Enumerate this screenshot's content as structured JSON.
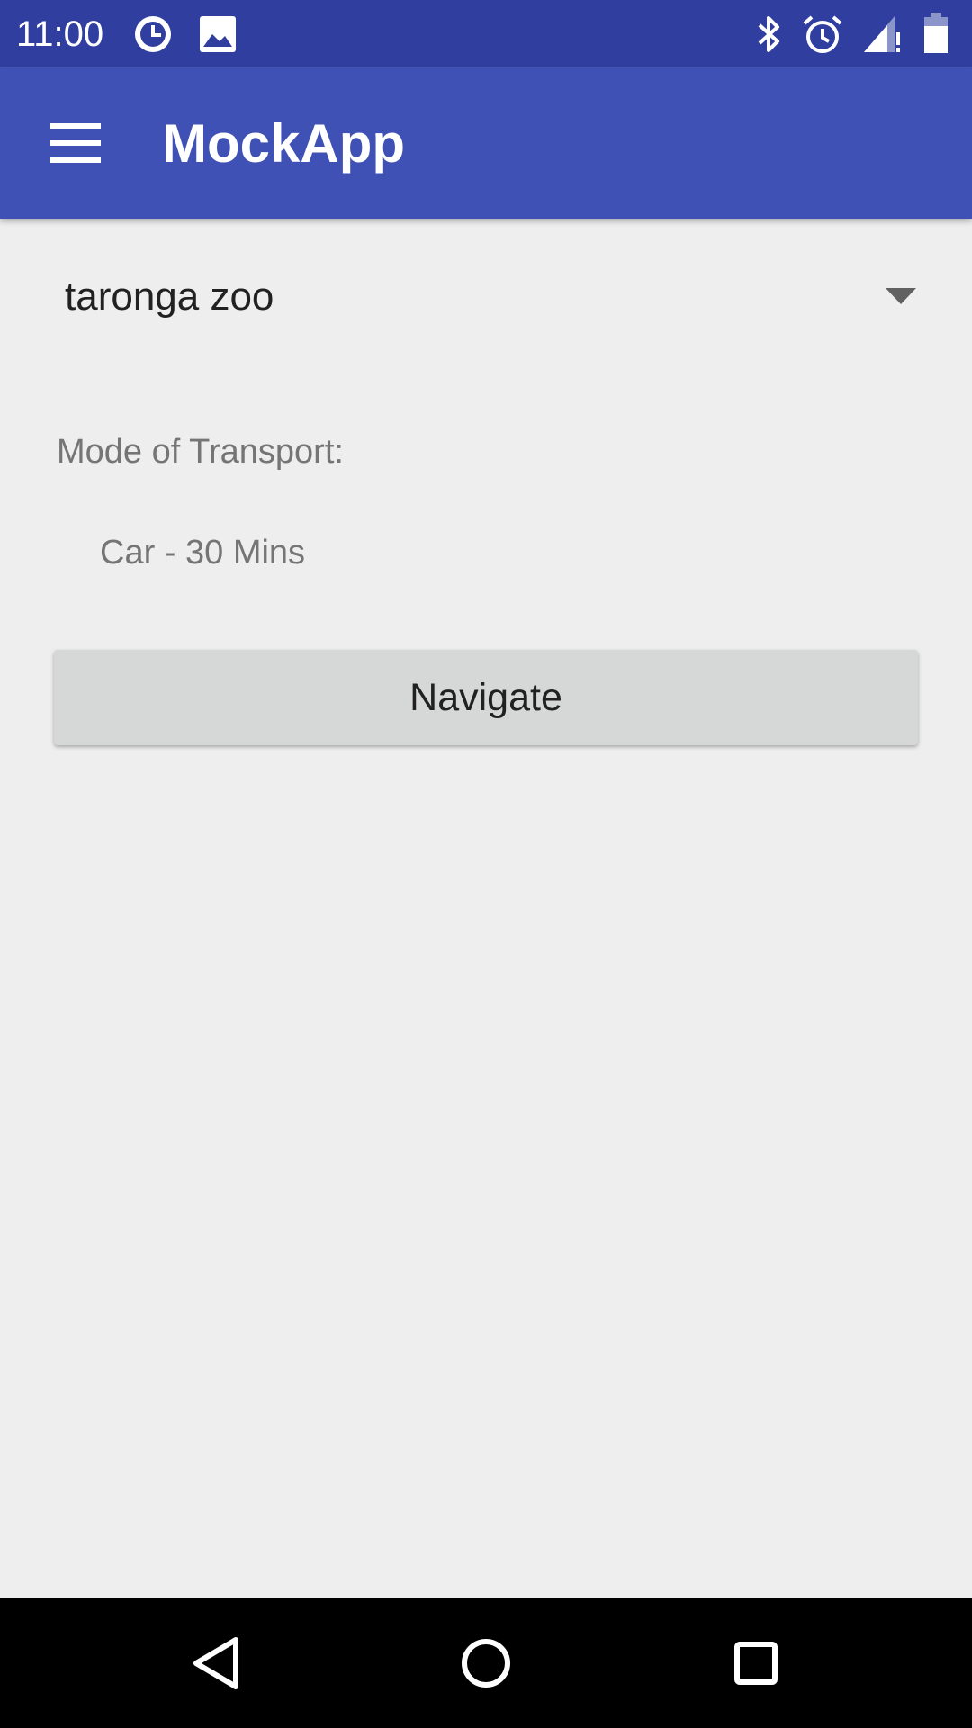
{
  "status_bar": {
    "time": "11:00",
    "left_icons": [
      "clock-notification-icon",
      "image-notification-icon"
    ],
    "right_icons": [
      "bluetooth-icon",
      "alarm-icon",
      "signal-icon",
      "battery-icon"
    ],
    "background": "#303f9f"
  },
  "app_bar": {
    "title": "MockApp",
    "menu_icon": "hamburger-menu-icon",
    "background": "#3f51b5"
  },
  "destination_spinner": {
    "selected": "taronga zoo"
  },
  "transport": {
    "label": "Mode of Transport:",
    "value": "Car - 30 Mins"
  },
  "navigate_button": {
    "label": "Navigate"
  },
  "nav_bar": {
    "buttons": [
      "back-icon",
      "home-icon",
      "recents-icon"
    ]
  }
}
